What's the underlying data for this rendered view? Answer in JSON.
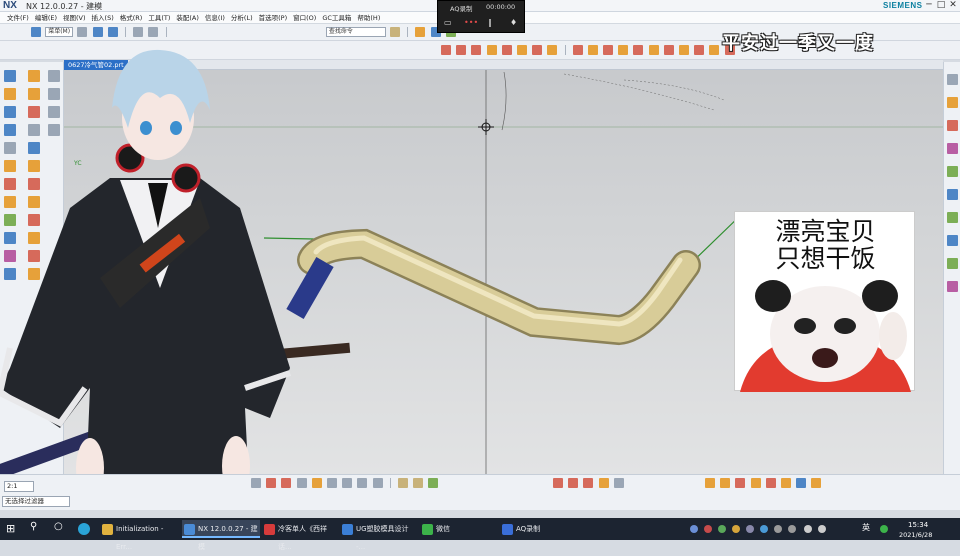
{
  "window": {
    "logo": "NX",
    "title": "NX 12.0.0.27 - 建模",
    "brand": "SIEMENS",
    "controls": [
      "─",
      "□",
      "✕"
    ]
  },
  "menu": {
    "items": [
      "文件(F)",
      "编辑(E)",
      "视图(V)",
      "插入(S)",
      "格式(R)",
      "工具(T)",
      "装配(A)",
      "信息(I)",
      "分析(L)",
      "首选项(P)",
      "窗口(O)",
      "GC工具箱",
      "帮助(H)"
    ]
  },
  "toolbar": {
    "search_value": "查找命令",
    "menu_label": "菜单(M)"
  },
  "recorder": {
    "title": "AQ录制",
    "time": "00:00:00"
  },
  "overlay": {
    "banner": "平安过一季又一度",
    "meme_line1": "漂亮宝贝",
    "meme_line2": "只想干饭"
  },
  "viewport": {
    "tab_label": "0627冷气管02.prt",
    "axis_label": "YC"
  },
  "bottom": {
    "zoom_value": "2:1",
    "filter_value": "无选择过滤器"
  },
  "taskbar": {
    "apps": [
      {
        "label": "Initialization - Err...",
        "color": "#e0b23f",
        "active": false
      },
      {
        "label": "NX 12.0.0.27 - 建模",
        "color": "#4a8bd6",
        "active": true
      },
      {
        "label": "冷客单人《西祥话...",
        "color": "#d63b3b",
        "active": false
      },
      {
        "label": "UG塑胶模具设计 -...",
        "color": "#3b7fd6",
        "active": false
      },
      {
        "label": "微信",
        "color": "#3cb34a",
        "active": false
      },
      {
        "label": "AQ录制",
        "color": "#3a6ed8",
        "active": false
      }
    ],
    "lang": "英",
    "time": "15:34",
    "date": "2021/6/28"
  },
  "colors": {
    "accent": "#2b6fc7",
    "pipe": "#d8cc98",
    "wire": "#2f8f2f"
  }
}
